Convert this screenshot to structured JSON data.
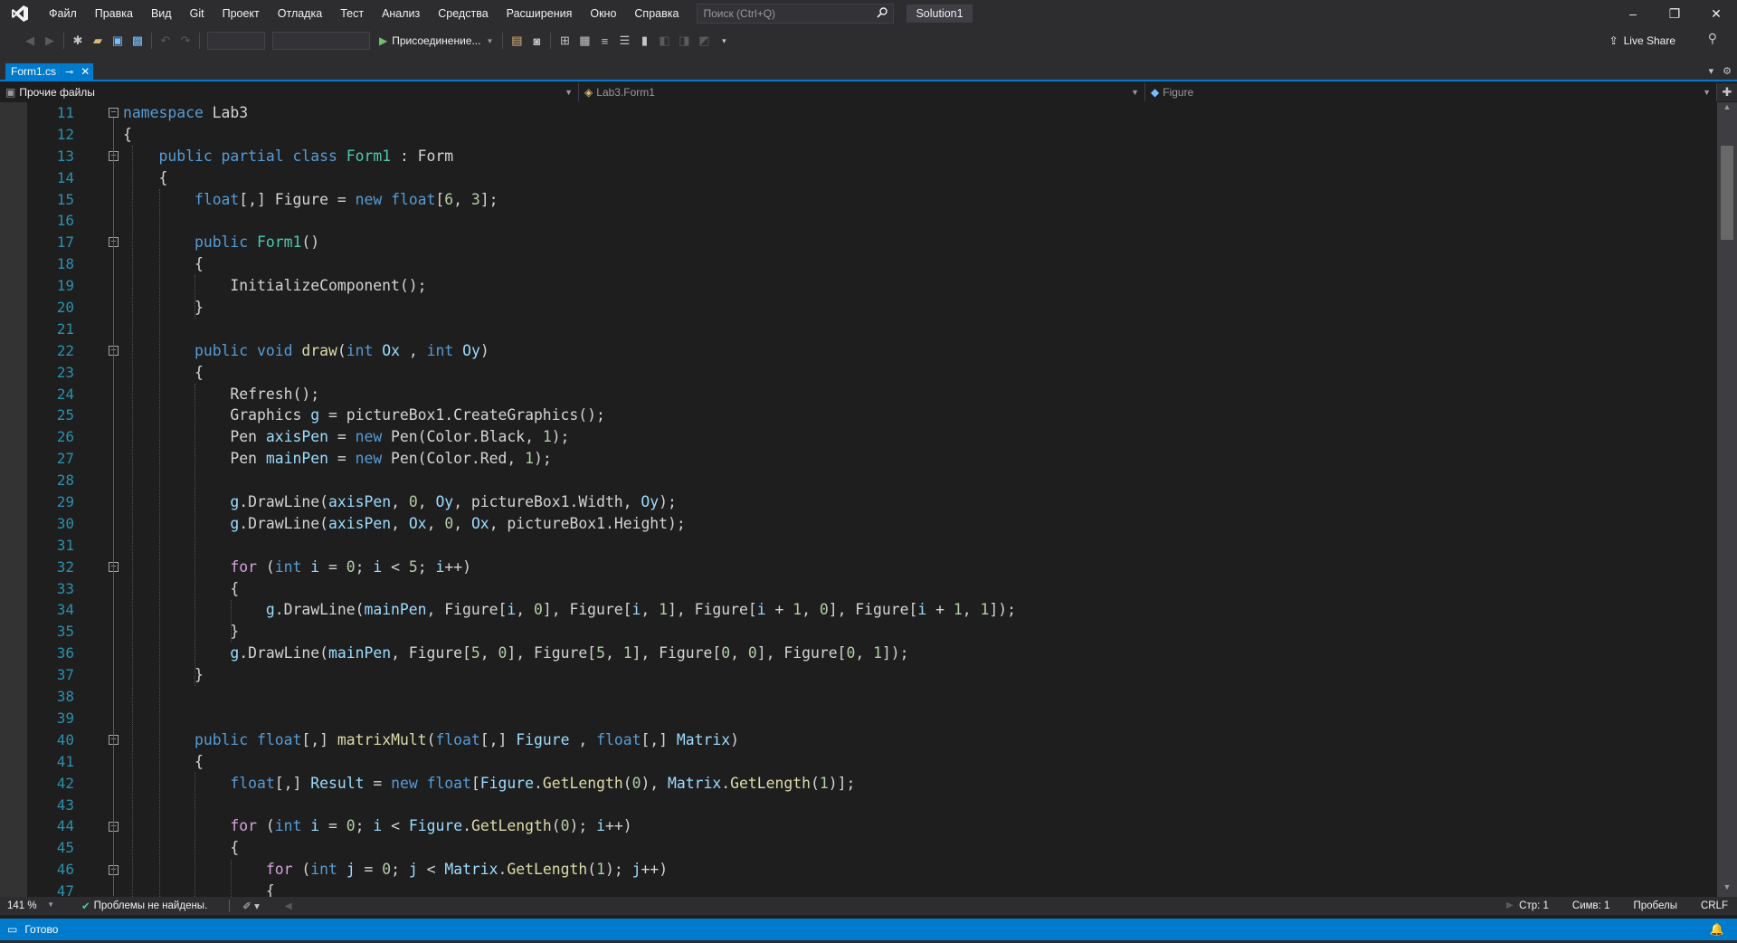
{
  "menu": [
    "Файл",
    "Правка",
    "Вид",
    "Git",
    "Проект",
    "Отладка",
    "Тест",
    "Анализ",
    "Средства",
    "Расширения",
    "Окно",
    "Справка"
  ],
  "search": {
    "placeholder": "Поиск (Ctrl+Q)"
  },
  "solution_name": "Solution1",
  "toolbar": {
    "run_label": "Присоединение...",
    "liveshare_label": "Live Share"
  },
  "tab": {
    "label": "Form1.cs"
  },
  "navbar": {
    "project": "Прочие файлы",
    "class": "Lab3.Form1",
    "member": "Figure"
  },
  "editor": {
    "first_line": 11,
    "lines": [
      [
        [
          "kw",
          "namespace"
        ],
        [
          "id",
          " Lab3"
        ]
      ],
      [
        [
          "id",
          "{"
        ]
      ],
      [
        [
          "id",
          "    "
        ],
        [
          "kw",
          "public partial class"
        ],
        [
          "id",
          " "
        ],
        [
          "typ",
          "Form1"
        ],
        [
          "id",
          " : Form"
        ]
      ],
      [
        [
          "id",
          "    {"
        ]
      ],
      [
        [
          "id",
          "        "
        ],
        [
          "kw",
          "float"
        ],
        [
          "id",
          "[,] Figure = "
        ],
        [
          "kw",
          "new"
        ],
        [
          "id",
          " "
        ],
        [
          "kw",
          "float"
        ],
        [
          "id",
          "["
        ],
        [
          "num",
          "6"
        ],
        [
          "id",
          ", "
        ],
        [
          "num",
          "3"
        ],
        [
          "id",
          "];"
        ]
      ],
      [],
      [
        [
          "id",
          "        "
        ],
        [
          "kw",
          "public"
        ],
        [
          "id",
          " "
        ],
        [
          "typ",
          "Form1"
        ],
        [
          "id",
          "()"
        ]
      ],
      [
        [
          "id",
          "        {"
        ]
      ],
      [
        [
          "id",
          "            InitializeComponent();"
        ]
      ],
      [
        [
          "id",
          "        }"
        ]
      ],
      [],
      [
        [
          "id",
          "        "
        ],
        [
          "kw",
          "public void"
        ],
        [
          "id",
          " "
        ],
        [
          "mth",
          "draw"
        ],
        [
          "id",
          "("
        ],
        [
          "kw",
          "int"
        ],
        [
          "id",
          " "
        ],
        [
          "loc",
          "Ox"
        ],
        [
          "id",
          " , "
        ],
        [
          "kw",
          "int"
        ],
        [
          "id",
          " "
        ],
        [
          "loc",
          "Oy"
        ],
        [
          "id",
          ")"
        ]
      ],
      [
        [
          "id",
          "        {"
        ]
      ],
      [
        [
          "id",
          "            Refresh();"
        ]
      ],
      [
        [
          "id",
          "            Graphics "
        ],
        [
          "loc",
          "g"
        ],
        [
          "id",
          " = pictureBox1.CreateGraphics();"
        ]
      ],
      [
        [
          "id",
          "            Pen "
        ],
        [
          "loc",
          "axisPen"
        ],
        [
          "id",
          " = "
        ],
        [
          "kw",
          "new"
        ],
        [
          "id",
          " Pen(Color.Black, "
        ],
        [
          "num",
          "1"
        ],
        [
          "id",
          ");"
        ]
      ],
      [
        [
          "id",
          "            Pen "
        ],
        [
          "loc",
          "mainPen"
        ],
        [
          "id",
          " = "
        ],
        [
          "kw",
          "new"
        ],
        [
          "id",
          " Pen(Color.Red, "
        ],
        [
          "num",
          "1"
        ],
        [
          "id",
          ");"
        ]
      ],
      [],
      [
        [
          "id",
          "            "
        ],
        [
          "loc",
          "g"
        ],
        [
          "id",
          ".DrawLine("
        ],
        [
          "loc",
          "axisPen"
        ],
        [
          "id",
          ", "
        ],
        [
          "num",
          "0"
        ],
        [
          "id",
          ", "
        ],
        [
          "loc",
          "Oy"
        ],
        [
          "id",
          ", pictureBox1.Width, "
        ],
        [
          "loc",
          "Oy"
        ],
        [
          "id",
          ");"
        ]
      ],
      [
        [
          "id",
          "            "
        ],
        [
          "loc",
          "g"
        ],
        [
          "id",
          ".DrawLine("
        ],
        [
          "loc",
          "axisPen"
        ],
        [
          "id",
          ", "
        ],
        [
          "loc",
          "Ox"
        ],
        [
          "id",
          ", "
        ],
        [
          "num",
          "0"
        ],
        [
          "id",
          ", "
        ],
        [
          "loc",
          "Ox"
        ],
        [
          "id",
          ", pictureBox1.Height);"
        ]
      ],
      [],
      [
        [
          "id",
          "            "
        ],
        [
          "ctl",
          "for"
        ],
        [
          "id",
          " ("
        ],
        [
          "kw",
          "int"
        ],
        [
          "id",
          " "
        ],
        [
          "loc",
          "i"
        ],
        [
          "id",
          " = "
        ],
        [
          "num",
          "0"
        ],
        [
          "id",
          "; "
        ],
        [
          "loc",
          "i"
        ],
        [
          "id",
          " < "
        ],
        [
          "num",
          "5"
        ],
        [
          "id",
          "; "
        ],
        [
          "loc",
          "i"
        ],
        [
          "id",
          "++)"
        ]
      ],
      [
        [
          "id",
          "            {"
        ]
      ],
      [
        [
          "id",
          "                "
        ],
        [
          "loc",
          "g"
        ],
        [
          "id",
          ".DrawLine("
        ],
        [
          "loc",
          "mainPen"
        ],
        [
          "id",
          ", Figure["
        ],
        [
          "loc",
          "i"
        ],
        [
          "id",
          ", "
        ],
        [
          "num",
          "0"
        ],
        [
          "id",
          "], Figure["
        ],
        [
          "loc",
          "i"
        ],
        [
          "id",
          ", "
        ],
        [
          "num",
          "1"
        ],
        [
          "id",
          "], Figure["
        ],
        [
          "loc",
          "i"
        ],
        [
          "id",
          " + "
        ],
        [
          "num",
          "1"
        ],
        [
          "id",
          ", "
        ],
        [
          "num",
          "0"
        ],
        [
          "id",
          "], Figure["
        ],
        [
          "loc",
          "i"
        ],
        [
          "id",
          " + "
        ],
        [
          "num",
          "1"
        ],
        [
          "id",
          ", "
        ],
        [
          "num",
          "1"
        ],
        [
          "id",
          "]);"
        ]
      ],
      [
        [
          "id",
          "            }"
        ]
      ],
      [
        [
          "id",
          "            "
        ],
        [
          "loc",
          "g"
        ],
        [
          "id",
          ".DrawLine("
        ],
        [
          "loc",
          "mainPen"
        ],
        [
          "id",
          ", Figure["
        ],
        [
          "num",
          "5"
        ],
        [
          "id",
          ", "
        ],
        [
          "num",
          "0"
        ],
        [
          "id",
          "], Figure["
        ],
        [
          "num",
          "5"
        ],
        [
          "id",
          ", "
        ],
        [
          "num",
          "1"
        ],
        [
          "id",
          "], Figure["
        ],
        [
          "num",
          "0"
        ],
        [
          "id",
          ", "
        ],
        [
          "num",
          "0"
        ],
        [
          "id",
          "], Figure["
        ],
        [
          "num",
          "0"
        ],
        [
          "id",
          ", "
        ],
        [
          "num",
          "1"
        ],
        [
          "id",
          "]);"
        ]
      ],
      [
        [
          "id",
          "        }"
        ]
      ],
      [],
      [],
      [
        [
          "id",
          "        "
        ],
        [
          "kw",
          "public"
        ],
        [
          "id",
          " "
        ],
        [
          "kw",
          "float"
        ],
        [
          "id",
          "[,] "
        ],
        [
          "mth",
          "matrixMult"
        ],
        [
          "id",
          "("
        ],
        [
          "kw",
          "float"
        ],
        [
          "id",
          "[,] "
        ],
        [
          "loc",
          "Figure"
        ],
        [
          "id",
          " , "
        ],
        [
          "kw",
          "float"
        ],
        [
          "id",
          "[,] "
        ],
        [
          "loc",
          "Matrix"
        ],
        [
          "id",
          ")"
        ]
      ],
      [
        [
          "id",
          "        {"
        ]
      ],
      [
        [
          "id",
          "            "
        ],
        [
          "kw",
          "float"
        ],
        [
          "id",
          "[,] "
        ],
        [
          "loc",
          "Result"
        ],
        [
          "id",
          " = "
        ],
        [
          "kw",
          "new"
        ],
        [
          "id",
          " "
        ],
        [
          "kw",
          "float"
        ],
        [
          "id",
          "["
        ],
        [
          "loc",
          "Figure"
        ],
        [
          "id",
          "."
        ],
        [
          "mth",
          "GetLength"
        ],
        [
          "id",
          "("
        ],
        [
          "num",
          "0"
        ],
        [
          "id",
          "), "
        ],
        [
          "loc",
          "Matrix"
        ],
        [
          "id",
          "."
        ],
        [
          "mth",
          "GetLength"
        ],
        [
          "id",
          "("
        ],
        [
          "num",
          "1"
        ],
        [
          "id",
          ")];"
        ]
      ],
      [],
      [
        [
          "id",
          "            "
        ],
        [
          "ctl",
          "for"
        ],
        [
          "id",
          " ("
        ],
        [
          "kw",
          "int"
        ],
        [
          "id",
          " "
        ],
        [
          "loc",
          "i"
        ],
        [
          "id",
          " = "
        ],
        [
          "num",
          "0"
        ],
        [
          "id",
          "; "
        ],
        [
          "loc",
          "i"
        ],
        [
          "id",
          " < "
        ],
        [
          "loc",
          "Figure"
        ],
        [
          "id",
          "."
        ],
        [
          "mth",
          "GetLength"
        ],
        [
          "id",
          "("
        ],
        [
          "num",
          "0"
        ],
        [
          "id",
          "); "
        ],
        [
          "loc",
          "i"
        ],
        [
          "id",
          "++)"
        ]
      ],
      [
        [
          "id",
          "            {"
        ]
      ],
      [
        [
          "id",
          "                "
        ],
        [
          "ctl",
          "for"
        ],
        [
          "id",
          " ("
        ],
        [
          "kw",
          "int"
        ],
        [
          "id",
          " "
        ],
        [
          "loc",
          "j"
        ],
        [
          "id",
          " = "
        ],
        [
          "num",
          "0"
        ],
        [
          "id",
          "; "
        ],
        [
          "loc",
          "j"
        ],
        [
          "id",
          " < "
        ],
        [
          "loc",
          "Matrix"
        ],
        [
          "id",
          "."
        ],
        [
          "mth",
          "GetLength"
        ],
        [
          "id",
          "("
        ],
        [
          "num",
          "1"
        ],
        [
          "id",
          "); "
        ],
        [
          "loc",
          "j"
        ],
        [
          "id",
          "++)"
        ]
      ],
      [
        [
          "id",
          "                {"
        ]
      ]
    ],
    "fold_lines": [
      11,
      13,
      17,
      22,
      32,
      40,
      44,
      46
    ]
  },
  "status": {
    "zoom": "141 %",
    "issues": "Проблемы не найдены.",
    "line": "Стр: 1",
    "col": "Симв: 1",
    "spaces": "Пробелы",
    "eol": "CRLF",
    "ready": "Готово"
  },
  "colors": {
    "accent": "#007acc",
    "keyword": "#569cd6",
    "type": "#4ec9b0",
    "method": "#dcdcaa",
    "number": "#b5cea8",
    "control": "#d8a0df",
    "local": "#9cdcfe",
    "line_number": "#2b91af"
  }
}
